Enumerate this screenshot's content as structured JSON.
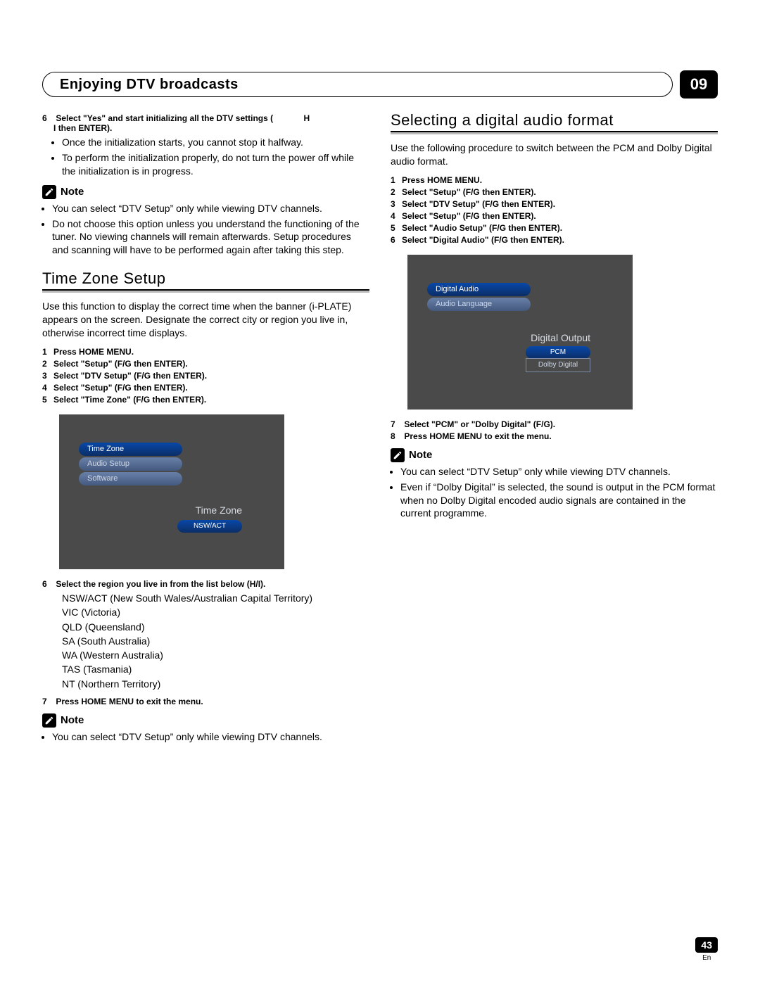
{
  "header": {
    "title": "Enjoying DTV broadcasts",
    "chapter": "09"
  },
  "left": {
    "step6a": "6",
    "step6a_text": "Select \"Yes\" and start initializing all the DTV settings (",
    "step6a_tail": "then",
    "sub_a": "Once the initialization starts, you cannot stop it halfway.",
    "sub_b": "To perform the initialization properly, do not turn the power off while the initialization is in progress.",
    "note1_label": "Note",
    "note1_items": [
      "You can select “DTV Setup” only while viewing DTV channels.",
      "Do not choose this option unless you understand the functioning of the tuner. No viewing channels will remain afterwards. Setup procedures and scanning will have to be performed again after taking this step."
    ],
    "tz_heading": "Time Zone Setup",
    "tz_intro": "Use this function to display the correct time when the banner (i-PLATE) appears on the screen. Designate the correct city or region you live in, otherwise incorrect time displays.",
    "tz_steps": [
      {
        "n": "1",
        "t": "Press HOME MENU."
      },
      {
        "n": "2",
        "t": "Select \"Setup\" (F/G then ENTER)."
      },
      {
        "n": "3",
        "t": "Select \"DTV Setup\" (F/G then ENTER)."
      },
      {
        "n": "4",
        "t": "Select \"Setup\" (F/G then ENTER)."
      },
      {
        "n": "5",
        "t": "Select \"Time Zone\" (F/G then ENTER)."
      }
    ],
    "tz_screenshot": {
      "tab_active": "Time Zone",
      "tab_dim1": "Audio Setup",
      "tab_dim2": "Software",
      "panel_label": "Time Zone",
      "option_sel": "NSW/ACT"
    },
    "tz_step6": {
      "n": "6",
      "t": "Select the region you live in from the list below (H/I)."
    },
    "regions": [
      "NSW/ACT (New South Wales/Australian Capital Territory)",
      "VIC (Victoria)",
      "QLD (Queensland)",
      "SA (South Australia)",
      "WA (Western Australia)",
      "TAS (Tasmania)",
      "NT (Northern Territory)"
    ],
    "tz_step7": {
      "n": "7",
      "t": "Press HOME MENU to exit the menu."
    },
    "note2_label": "Note",
    "note2_items": [
      "You can select “DTV Setup” only while viewing DTV channels."
    ]
  },
  "right": {
    "audio_heading": "Selecting a digital audio format",
    "audio_intro": "Use the following procedure to switch between the PCM and Dolby Digital audio format.",
    "audio_steps": [
      {
        "n": "1",
        "t": "Press HOME MENU."
      },
      {
        "n": "2",
        "t": "Select \"Setup\" (F/G then ENTER)."
      },
      {
        "n": "3",
        "t": "Select \"DTV Setup\" (F/G then ENTER)."
      },
      {
        "n": "4",
        "t": "Select \"Setup\" (F/G then ENTER)."
      },
      {
        "n": "5",
        "t": "Select \"Audio Setup\" (F/G then ENTER)."
      },
      {
        "n": "6",
        "t": "Select \"Digital Audio\" (F/G then ENTER)."
      }
    ],
    "audio_screenshot": {
      "tab_active": "Digital Audio",
      "tab_dim1": "Audio Language",
      "panel_label": "Digital Output",
      "option_sel": "PCM",
      "option_other": "Dolby Digital"
    },
    "audio_step7": {
      "n": "7",
      "t": "Select \"PCM\" or \"Dolby Digital\" (F/G)."
    },
    "audio_step8": {
      "n": "8",
      "t": "Press HOME MENU to exit the menu."
    },
    "note3_label": "Note",
    "note3_items": [
      "You can select “DTV Setup” only while viewing DTV channels.",
      "Even if “Dolby Digital” is selected, the sound is output in the PCM format when no Dolby Digital encoded audio signals are contained in the current programme."
    ]
  },
  "footer": {
    "page": "43",
    "lang": "En"
  }
}
